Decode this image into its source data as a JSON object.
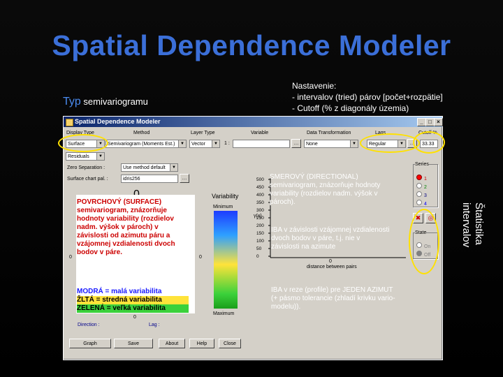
{
  "slide": {
    "title": "Spatial Dependence Modeler",
    "typ_label": "Typ",
    "typ_rest": "semivariogramu",
    "nastavenie": [
      "Nastavenie:",
      "- intervalov (tried) párov [počet+rozpätie]",
      "- Cutoff (% z diagonály územia)"
    ],
    "statistika": [
      "Štatistika",
      "intervalov"
    ]
  },
  "window": {
    "title": "Spatial Dependence Modeler",
    "labels": {
      "display_type": "Display Type",
      "method": "Method",
      "layer_type": "Layer Type",
      "variable": "Variable",
      "data_transformation": "Data Transformation",
      "lags": "Lags",
      "cutoff": "Cutoff %",
      "zero_separation": "Zero Separation :",
      "surface_chart_pal": "Surface chart pal. :",
      "variability": "Variability",
      "minimum": "Minimum",
      "maximum": "Maximum",
      "direction": "Direction :",
      "lag": "Lag :",
      "series": "Series",
      "state": "State",
      "distance_between_pairs": "distance between pairs",
      "y_axis": "γ(x)",
      "colon_one": "1 :"
    },
    "values": {
      "display_type": "Surface",
      "method": "Semivariogram (Moments Est.)",
      "layer_type": "Vector",
      "variable": "",
      "data_transformation": "None",
      "lags": "Regular",
      "cutoff": "33.33",
      "residuals": "Residuals",
      "zero_separation": "Use method default",
      "palette": "idris256"
    },
    "series": [
      "1",
      "2",
      "3",
      "4"
    ],
    "state": [
      "On",
      "Off"
    ],
    "y_ticks": [
      "500",
      "450",
      "400",
      "350",
      "300",
      "250",
      "200",
      "150",
      "100",
      "50",
      "0"
    ],
    "x_tick": "0",
    "surface_ticks": {
      "top": "0",
      "left": "0",
      "right": "0",
      "bottom": "0"
    },
    "buttons": [
      "Graph",
      "Save",
      "About",
      "Help",
      "Close"
    ]
  },
  "overlays": {
    "surface": "POVRCHOVÝ (SURFACE) semivariogram, znázorňuje hodnoty variability (rozdielov nadm. výšok v pároch) v závislosti od azimutu páru a vzájomnej vzdialenosti dvoch bodov v páre.",
    "legend": [
      "MODRÁ = malá variabilita",
      "ŽLTÁ = stredná variabilita",
      "ZELENÁ = veľká variabilita"
    ],
    "directional": "SMEROVÝ (DIRECTIONAL) semivariogram, znázorňuje hodnoty variability (rozdielov nadm. výšok v pároch).",
    "iba_vzdialenost": "IBA v závislosti vzájomnej vzdialenosti dvoch bodov v páre, t.j. nie v závislosti na azimute",
    "iba_rez": "IBA v reze (profile) pre JEDEN AZIMUT (+ pásmo tolerancie (zhladí krivku vario-modelu))."
  },
  "colors": {
    "title_blue": "#3b6fd8",
    "highlight_yellow": "#ffe100",
    "overlay_red": "#cc0000",
    "overlay_white": "#ffffff"
  }
}
